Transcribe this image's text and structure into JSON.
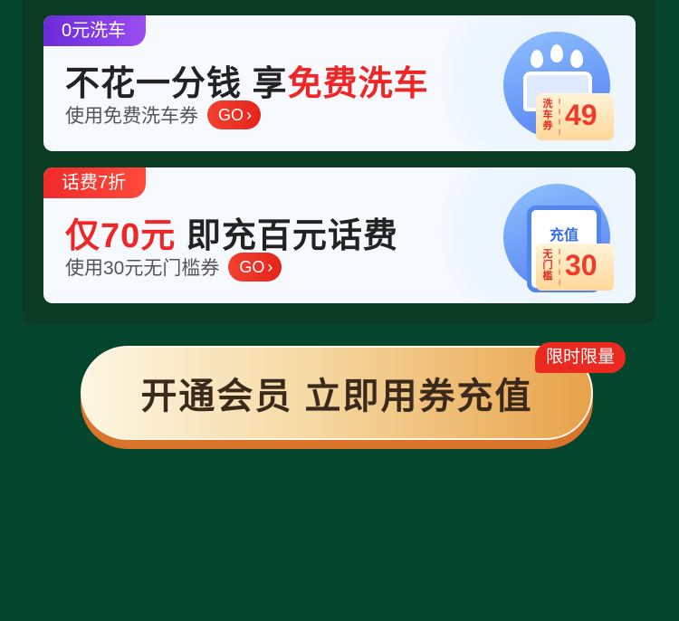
{
  "cards": [
    {
      "tag": "0元洗车",
      "headline_prefix": "不花一分钱 享",
      "headline_highlight": "免费洗车",
      "subtitle": "使用免费洗车券",
      "go_label": "GO",
      "coupon_label": "洗车券",
      "coupon_value": "49"
    },
    {
      "tag": "话费7折",
      "headline_highlight": "仅70元",
      "headline_suffix": " 即充百元话费",
      "subtitle": "使用30元无门槛券",
      "go_label": "GO",
      "phone_label": "充值",
      "coupon_label": "无门槛",
      "coupon_value": "30"
    }
  ],
  "cta": {
    "label": "开通会员 立即用券充值",
    "badge": "限时限量"
  },
  "colors": {
    "background": "#03452d",
    "accent_red": "#f02525",
    "tag_purple": "#7b35e0"
  }
}
